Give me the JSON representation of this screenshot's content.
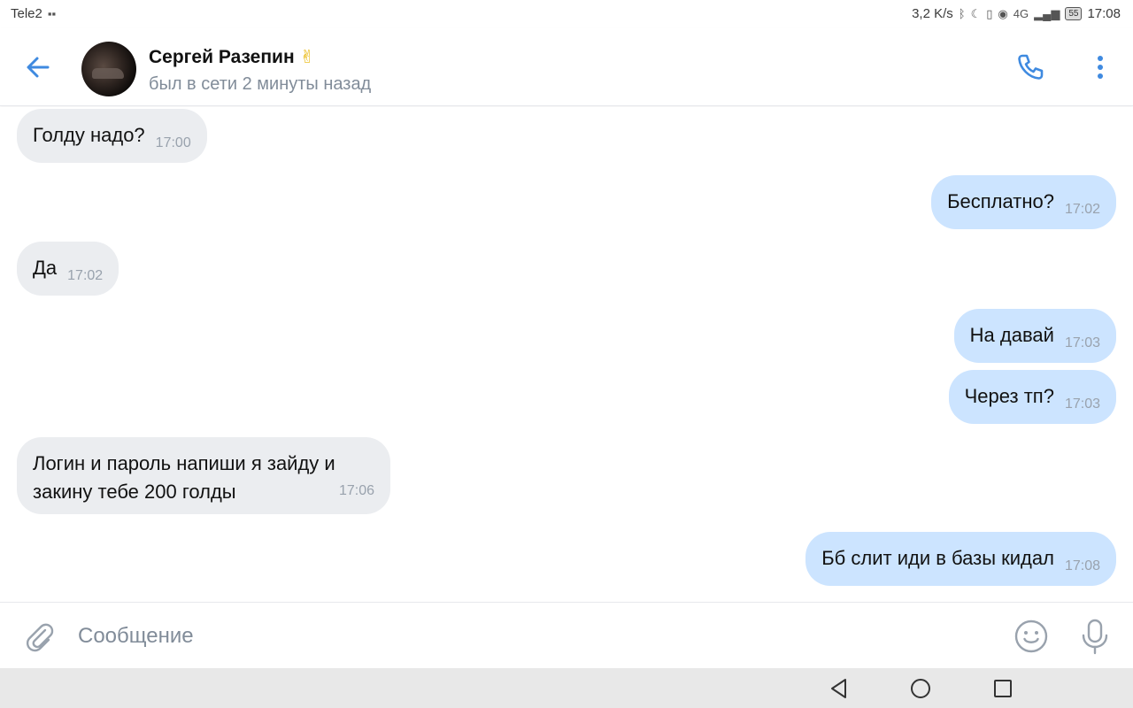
{
  "status_bar": {
    "carrier": "Tele2",
    "speed": "3,2 K/s",
    "signal": "4G",
    "battery": "55",
    "time": "17:08"
  },
  "header": {
    "contact_name": "Сергей Разепин",
    "contact_emoji": "✌",
    "contact_status": "был в сети 2 минуты назад"
  },
  "messages": [
    {
      "direction": "in",
      "text": "Голду надо?",
      "time": "17:00"
    },
    {
      "direction": "out",
      "text": "Бесплатно?",
      "time": "17:02"
    },
    {
      "direction": "in",
      "text": "Да",
      "time": "17:02"
    },
    {
      "direction": "out",
      "text": "На давай",
      "time": "17:03"
    },
    {
      "direction": "out",
      "text": "Через тп?",
      "time": "17:03"
    },
    {
      "direction": "in",
      "text": "Логин и пароль напиши я зайду и закину тебе 200 голды",
      "time": "17:06"
    },
    {
      "direction": "out",
      "text": "Бб слит иди в базы кидал",
      "time": "17:08"
    }
  ],
  "composer": {
    "placeholder": "Сообщение"
  },
  "colors": {
    "accent": "#3f8ae0",
    "incoming_bubble": "#ebedf0",
    "outgoing_bubble": "#cce4ff",
    "secondary_text": "#818c99"
  },
  "icons": {
    "back": "arrow-left-icon",
    "call": "phone-icon",
    "more": "more-vertical-icon",
    "attach": "paperclip-icon",
    "emoji": "smile-icon",
    "mic": "microphone-icon"
  }
}
